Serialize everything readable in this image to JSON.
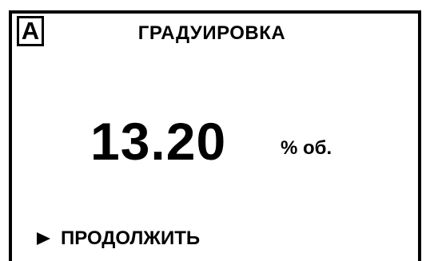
{
  "screen": {
    "mode_badge": "A",
    "title": "ГРАДУИРОВКА",
    "measurement": {
      "value": "13.20",
      "unit": "% об."
    },
    "menu": {
      "continue_label": "ПРОДОЛЖИТЬ",
      "selector_icon": "triangle-right-icon"
    }
  },
  "colors": {
    "background": "#ffffff",
    "foreground": "#000000"
  }
}
